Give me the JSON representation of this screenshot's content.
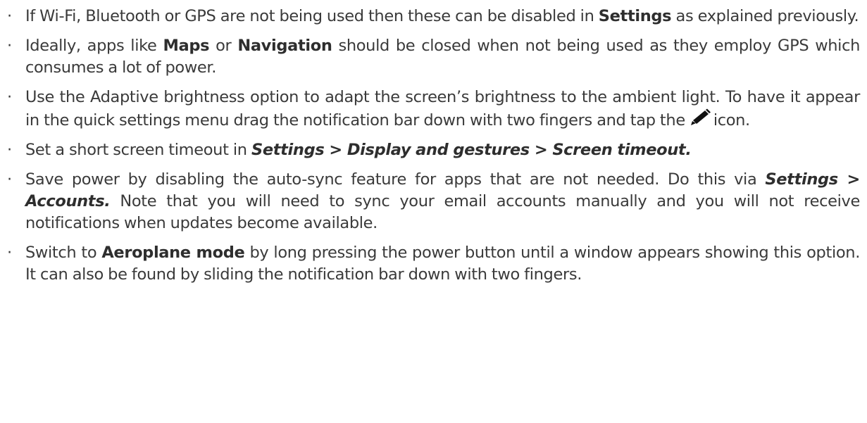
{
  "bullet_char": "·",
  "tips": [
    {
      "p1": "If Wi-Fi, Bluetooth or GPS are not being used then these can be disabled in ",
      "b1": "Settings",
      "p2": " as explained previously."
    },
    {
      "p1": "Ideally, apps like ",
      "b1": "Maps",
      "p2": " or ",
      "b2": "Navigation",
      "p3": " should be closed when not being used as they employ GPS which consumes a lot of power."
    },
    {
      "p1": "Use the Adaptive brightness option to adapt the screen’s brightness to the ambient light. To have it appear in the quick settings menu drag the notification bar down with two fingers and tap the",
      "icon": "pencil-icon",
      "p2": "icon."
    },
    {
      "p1": "Set a short screen timeout in ",
      "path1": "Settings > Display and gestures > Screen timeout."
    },
    {
      "p1": "Save power by disabling the auto-sync feature for apps that are not needed. Do this via ",
      "path1": "Settings > Accounts.",
      "p2": " Note that you will need to sync your email accounts manually and you will not receive notifications when updates become available."
    },
    {
      "p1": "Switch to ",
      "b1": "Aeroplane mode",
      "p2": " by long pressing the power button until a window appears showing this option. It can also be found by sliding the notification bar down with two fingers."
    }
  ]
}
